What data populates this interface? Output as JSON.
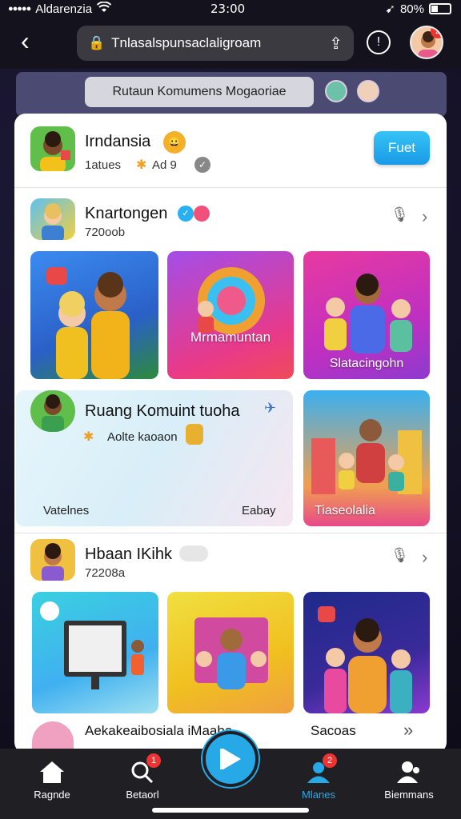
{
  "status": {
    "carrier": "Aldarenzia",
    "time": "23:00",
    "battery": "80%"
  },
  "browser": {
    "url": "Tnlasalspunsaclaligroam"
  },
  "banner": {
    "label": "Rutaun Komumens Mogaoriae"
  },
  "profile": {
    "name": "Irndansia",
    "meta_left": "1atues",
    "meta_right": "Ad 9",
    "follow_label": "Fuet"
  },
  "section1": {
    "title": "Knartongen",
    "sub": "720oob"
  },
  "tiles1": [
    {
      "caption": ""
    },
    {
      "caption": "Mrmamuntan"
    },
    {
      "caption": "Slatacingohn"
    }
  ],
  "featured": {
    "title": "Ruang Komuint tuoha",
    "sub": "Aolte kaoaon",
    "left_caption": "Vatelnes",
    "right_caption": "Eabay",
    "side_caption": "Tiaseolalia"
  },
  "section2": {
    "title": "Hbaan IKihk",
    "sub": "72208a"
  },
  "tiles2": [
    {
      "caption": ""
    },
    {
      "caption": ""
    },
    {
      "caption": ""
    }
  ],
  "bottom_row": {
    "title": "Aekakeaibosiala iMaaba",
    "right": "Sacoas"
  },
  "nav": [
    {
      "label": "Ragnde",
      "badge": ""
    },
    {
      "label": "Betaorl",
      "badge": "1"
    },
    {
      "label": "",
      "badge": ""
    },
    {
      "label": "Mlanes",
      "badge": "2"
    },
    {
      "label": "Biemmans",
      "badge": ""
    }
  ],
  "colors": {
    "accent": "#27a9e8",
    "badge": "#e33333",
    "highlight": "#2ab0f0"
  }
}
